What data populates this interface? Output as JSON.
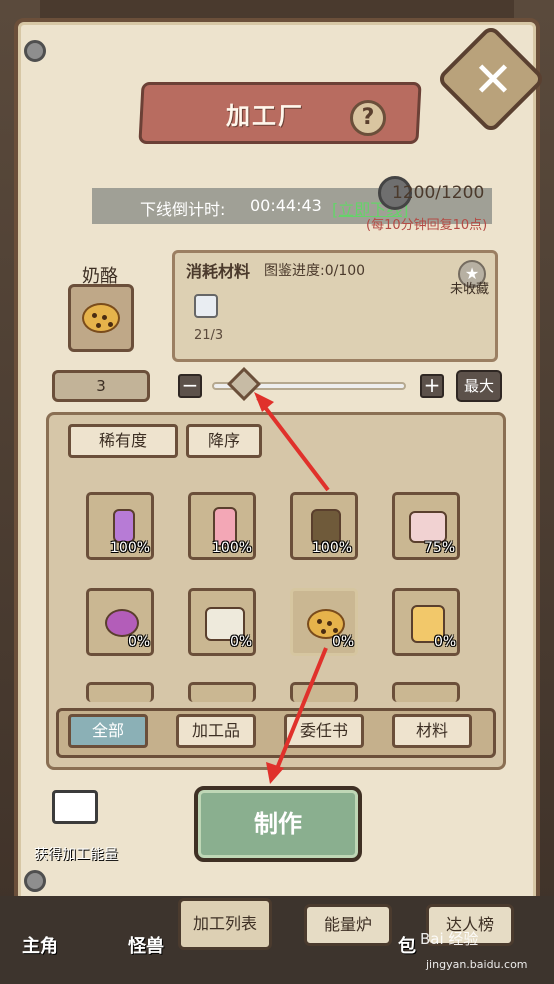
{
  "title": "加工厂",
  "countdown": {
    "label": "下线倒计时:",
    "time": "00:44:43",
    "link": "[立即下线]",
    "energy": "1200/1200",
    "recover": "(每10分钟回复10点)"
  },
  "item": {
    "name": "奶酪"
  },
  "materials": {
    "title": "消耗材料",
    "progress": "图鉴进度:0/100",
    "favorite": "未收藏",
    "count": "21/3"
  },
  "quantity": {
    "value": "3",
    "max_label": "最大",
    "minus": "−",
    "plus": "+"
  },
  "sort": {
    "rarity": "稀有度",
    "order": "降序"
  },
  "grid": [
    {
      "pct": "100%"
    },
    {
      "pct": "100%"
    },
    {
      "pct": "100%"
    },
    {
      "pct": "75%"
    },
    {
      "pct": "0%"
    },
    {
      "pct": "0%"
    },
    {
      "pct": "0%"
    },
    {
      "pct": "0%"
    }
  ],
  "tabs": [
    "全部",
    "加工品",
    "委任书",
    "材料"
  ],
  "make_button": "制作",
  "video_label": "获得加工能量",
  "bottom_nav": {
    "buttons": [
      "加工列表",
      "能量炉",
      "达人榜"
    ],
    "side_labels": [
      "主角",
      "怪兽",
      "包"
    ]
  },
  "watermark": {
    "brand": "Bai 经验",
    "url": "jingyan.baidu.com"
  },
  "colors": {
    "panel": "#ede3cd",
    "ribbon": "#b86c60",
    "make_button": "#8aaf8f",
    "active_tab": "#8bb0b6",
    "arrow": "#e0312b"
  }
}
